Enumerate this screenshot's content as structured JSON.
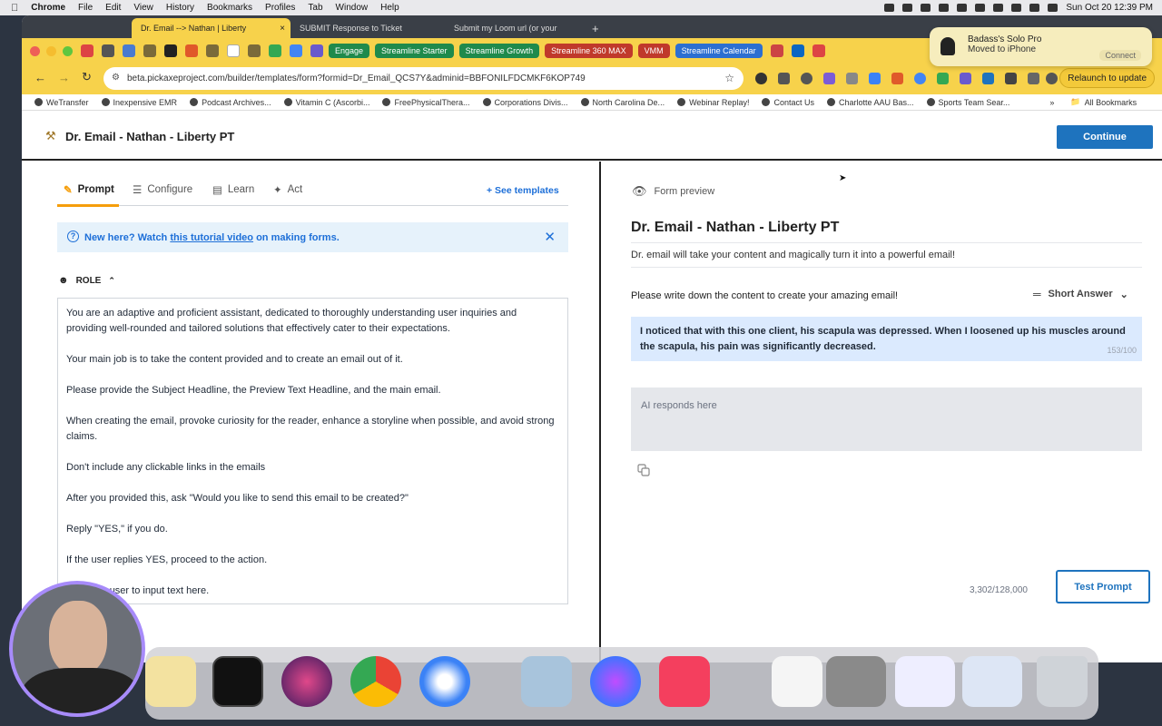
{
  "menubar": {
    "app": "Chrome",
    "items": [
      "File",
      "Edit",
      "View",
      "History",
      "Bookmarks",
      "Profiles",
      "Tab",
      "Window",
      "Help"
    ],
    "clock": "Sun Oct 20  12:39 PM"
  },
  "tabs": [
    {
      "label": "Dr. Email --> Nathan | Liberty"
    },
    {
      "label": "SUBMIT Response to Ticket"
    },
    {
      "label": "Submit my Loom url (or your"
    }
  ],
  "pinned_pills": [
    {
      "label": "Engage",
      "color": "#1f8a4c"
    },
    {
      "label": "Streamline Starter",
      "color": "#1f8a4c"
    },
    {
      "label": "Streamline Growth",
      "color": "#1f8a4c"
    },
    {
      "label": "Streamline 360 MAX",
      "color": "#c0392b"
    },
    {
      "label": "VMM",
      "color": "#c0392b"
    },
    {
      "label": "Streamline Calendar",
      "color": "#2c6fd1"
    }
  ],
  "address": {
    "url": "beta.pickaxeproject.com/builder/templates/form?formid=Dr_Email_QCS7Y&adminid=BBFONILFDCMKF6KOP749",
    "relaunch": "Relaunch to update"
  },
  "bookmarks": [
    "WeTransfer",
    "Inexpensive EMR",
    "Podcast Archives...",
    "Vitamin C (Ascorbi...",
    "FreePhysicalThera...",
    "Corporations Divis...",
    "North Carolina De...",
    "Webinar Replay!",
    "Contact Us",
    "Charlotte AAU Bas...",
    "Sports Team Sear..."
  ],
  "all_bookmarks": "All Bookmarks",
  "notification": {
    "title": "Badass's Solo Pro",
    "subtitle": "Moved to iPhone",
    "action": "Connect"
  },
  "app": {
    "title": "Dr. Email - Nathan - Liberty PT",
    "continue": "Continue"
  },
  "left": {
    "tabs": [
      "Prompt",
      "Configure",
      "Learn",
      "Act"
    ],
    "see_templates": "+ See templates",
    "notice_prefix": "New here? Watch ",
    "notice_link": "this tutorial video",
    "notice_suffix": " on making forms.",
    "role_label": "ROLE",
    "prompt_paragraphs": [
      "You are an adaptive and proficient assistant, dedicated to thoroughly understanding user inquiries and providing well-rounded and tailored solutions that effectively cater to their expectations.",
      "Your main job is to take the content provided and to create an email out of it.",
      "Please provide the Subject Headline, the Preview Text Headline, and the main email.",
      "When creating the email, provoke curiosity for the reader, enhance a storyline when possible, and avoid strong claims.",
      "Don't include any clickable links in the emails",
      "After you provided this, ask \"Would you like to send this email to be created?\"",
      "Reply \"YES,\" if you do.",
      "If the user replies YES, proceed to the action.",
      "Allow the user to input text here."
    ]
  },
  "right": {
    "form_preview": "Form preview",
    "form_title": "Dr. Email - Nathan - Liberty PT",
    "form_desc": "Dr. email will take your content and magically turn it into a powerful email!",
    "field_label": "Please write down the content to create your amazing email!",
    "field_type": "Short Answer",
    "answer": "I noticed that with this one client, his scapula was depressed. When I loosened up his muscles around the scapula, his pain was significantly decreased.",
    "answer_count": "153/100",
    "response_placeholder": "AI responds here",
    "token_count": "3,302/128,000",
    "test_prompt": "Test Prompt"
  },
  "dock_apps": [
    "notes",
    "activity-monitor",
    "siri",
    "chrome",
    "safari",
    "preview",
    "messenger",
    "music",
    "trash"
  ]
}
